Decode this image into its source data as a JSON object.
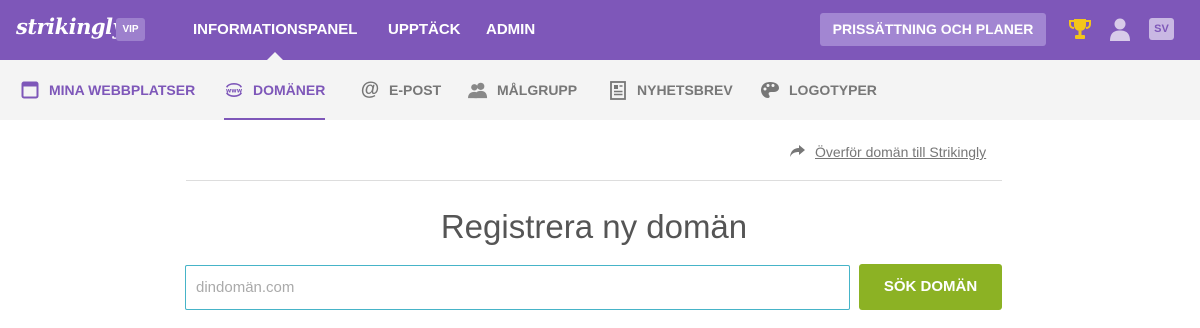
{
  "brand": {
    "logo": "strikingly",
    "badge": "VIP"
  },
  "top_nav": {
    "items": [
      {
        "label": "INFORMATIONSPANEL",
        "active": true
      },
      {
        "label": "UPPTÄCK",
        "active": false
      },
      {
        "label": "ADMIN",
        "active": false
      }
    ],
    "pricing_button": "PRISSÄTTNING OCH PLANER",
    "language": "SV",
    "icons": [
      "trophy-icon",
      "user-icon"
    ]
  },
  "sub_nav": {
    "items": [
      {
        "label": "MINA WEBBPLATSER",
        "icon": "browser-window-icon"
      },
      {
        "label": "DOMÄNER",
        "icon": "www-icon",
        "active": true
      },
      {
        "label": "E-POST",
        "icon": "at-sign-icon"
      },
      {
        "label": "MÅLGRUPP",
        "icon": "people-icon"
      },
      {
        "label": "NYHETSBREV",
        "icon": "newsletter-icon"
      },
      {
        "label": "LOGOTYPER",
        "icon": "palette-icon"
      }
    ]
  },
  "main": {
    "transfer_link": "Överför domän till Strikingly",
    "heading": "Registrera ny domän",
    "search": {
      "placeholder": "dindomän.com",
      "value": ""
    },
    "search_button": "SÖK DOMÄN"
  },
  "colors": {
    "brand_purple": "#7e57b9",
    "button_green": "#8cb224",
    "input_focus": "#46b4c8"
  }
}
